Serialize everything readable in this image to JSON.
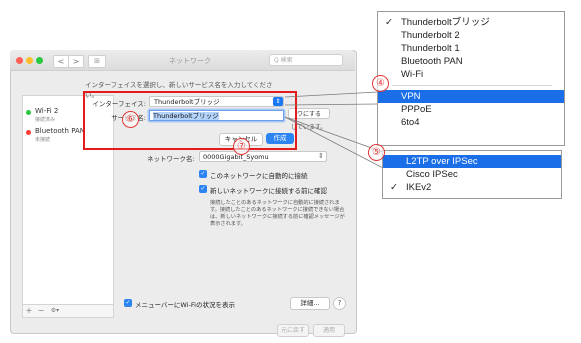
{
  "window": {
    "title": "ネットワーク",
    "search_placeholder": "Q 検索",
    "nav_back": "<",
    "nav_forward": ">",
    "grid": "⊞"
  },
  "sidebar": {
    "items": [
      {
        "name": "Wi-Fi 2",
        "status": "接続済み",
        "dot_color": "#28c840"
      },
      {
        "name": "Bluetooth PAN",
        "status": "未接続",
        "dot_color": "#ff3b30"
      }
    ],
    "add": "+",
    "remove": "−",
    "gear": "⚙▾"
  },
  "sheet": {
    "instruction": "インターフェイスを選択し、新しいサービス名を入力してください。",
    "interface_label": "インターフェイス:",
    "interface_value": "Thunderboltブリッジ",
    "service_label": "サービス名:",
    "service_value": "Thunderboltブリッジ",
    "cancel": "キャンセル",
    "create": "作成",
    "behind_button": "ワにする",
    "behind_text": "しています。"
  },
  "main": {
    "network_name_label": "ネットワーク名:",
    "network_name_value": "0000Gigabit_Syomu",
    "auto_join": "このネットワークに自動的に接続",
    "ask_join": "新しいネットワークに接続する前に確認",
    "description": "接続したことのあるネットワークに自動的に接続されます。接続したことのあるネットワークに接続できない場合は、新しいネットワークに接続する前に確認メッセージが表示されます。",
    "menubar_status": "メニューバーにWi-Fiの状況を表示",
    "advanced": "詳細...",
    "help": "?",
    "revert": "元に戻す",
    "apply": "適用"
  },
  "annotations": {
    "n4": "④",
    "n5": "⑤",
    "n6": "⑥",
    "n7": "⑦",
    "color": "#e21b1b"
  },
  "interface_menu": {
    "items": [
      {
        "label": "Thunderboltブリッジ",
        "checked": "✓"
      },
      {
        "label": "Thunderbolt 2",
        "checked": ""
      },
      {
        "label": "Thunderbolt 1",
        "checked": ""
      },
      {
        "label": "Bluetooth PAN",
        "checked": ""
      },
      {
        "label": "Wi-Fi",
        "checked": ""
      },
      {
        "label": "VPN",
        "checked": "",
        "selected": true
      },
      {
        "label": "PPPoE",
        "checked": ""
      },
      {
        "label": "6to4",
        "checked": ""
      }
    ]
  },
  "vpn_menu": {
    "items": [
      {
        "label": "L2TP over IPSec",
        "checked": "",
        "selected": true
      },
      {
        "label": "Cisco IPSec",
        "checked": ""
      },
      {
        "label": "IKEv2",
        "checked": "✓"
      }
    ]
  },
  "colors": {
    "accent": "#1a6fe8",
    "button_blue": "#2c83f2"
  }
}
